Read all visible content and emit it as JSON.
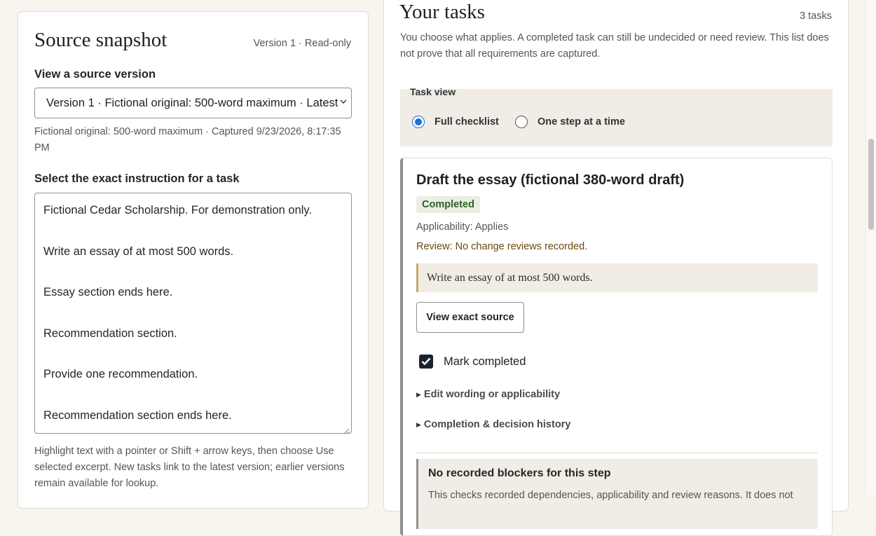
{
  "source_panel": {
    "title": "Source snapshot",
    "meta": "Version 1 · Read-only",
    "version_label": "View a source version",
    "version_selected": "Version 1 · Fictional original: 500-word maximum · Latest",
    "capture_info": "Fictional original: 500-word maximum · Captured 9/23/2026, 8:17:35 PM",
    "instruction_label": "Select the exact instruction for a task",
    "source_lines": [
      "Fictional Cedar Scholarship. For demonstration only.",
      "Write an essay of at most 500 words.",
      "Essay section ends here.",
      "Recommendation section.",
      "Provide one recommendation.",
      "Recommendation section ends here."
    ],
    "help_text": "Highlight text with a pointer or Shift + arrow keys, then choose Use selected excerpt. New tasks link to the latest version; earlier versions remain available for lookup."
  },
  "tasks_panel": {
    "title": "Your tasks",
    "count": "3 tasks",
    "intro": "You choose what applies. A completed task can still be undecided or need review. This list does not prove that all requirements are captured.",
    "task_view": {
      "legend": "Task view",
      "options": [
        "Full checklist",
        "One step at a time"
      ],
      "selected": "Full checklist"
    },
    "task": {
      "title": "Draft the essay (fictional 380-word draft)",
      "status": "Completed",
      "applicability": "Applicability: Applies",
      "review": "Review: No change reviews recorded.",
      "quote": "Write an essay of at most 500 words.",
      "view_source": "View exact source",
      "mark_completed": "Mark completed",
      "mark_completed_checked": true,
      "edit_summary": "Edit wording or applicability",
      "history_summary": "Completion & decision history",
      "blockers_title": "No recorded blockers for this step",
      "blockers_body": "This checks recorded dependencies, applicability and review reasons. It does not"
    }
  },
  "colors": {
    "page_bg": "#f8f4ee",
    "accent": "#1f6fd8",
    "status_badge_bg": "#e9efe2",
    "status_badge_text": "#2f5d2a",
    "review_text": "#6b4a10"
  }
}
